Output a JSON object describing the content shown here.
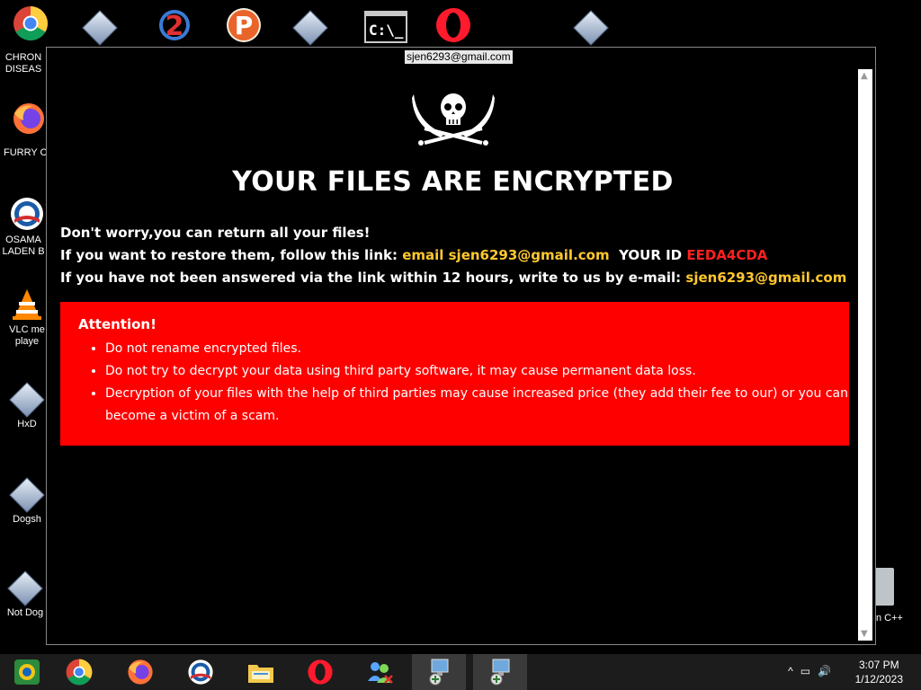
{
  "desktop": {
    "icons_left": [
      {
        "label_line1": "CHRON",
        "label_line2": "DISEAS",
        "icon": "chrome-icon"
      },
      {
        "label_line1": "FURRY CU",
        "label_line2": "",
        "icon": "firefox-icon"
      },
      {
        "label_line1": "OSAMA",
        "label_line2": "LADEN B",
        "icon": "obama-icon"
      },
      {
        "label_line1": "VLC me",
        "label_line2": "playe",
        "icon": "vlc-icon"
      },
      {
        "label_line1": "HxD",
        "label_line2": "",
        "icon": "app-icon"
      },
      {
        "label_line1": "Dogsh",
        "label_line2": "",
        "icon": "app-icon"
      },
      {
        "label_line1": "Not Dog",
        "label_line2": "",
        "icon": "app-icon"
      }
    ],
    "icon_right_label": "n C++",
    "top_row_icons": [
      "chrome-icon",
      "app-icon",
      "number2-icon",
      "p-icon",
      "app-icon",
      "cmd-icon",
      "opera-icon",
      "app-icon"
    ]
  },
  "window": {
    "title": "sjen6293@gmail.com",
    "heading": "YOUR FILES ARE ENCRYPTED",
    "line1": "Don't worry,you can return all your files!",
    "line2_prefix": "If you want to restore them, follow this link: ",
    "line2_link": "email sjen6293@gmail.com",
    "line2_id_label": "YOUR ID ",
    "line2_id_value": "EEDA4CDA",
    "line3_prefix": "If you have not been answered via the link within 12 hours, write to us by e-mail: ",
    "line3_email": "sjen6293@gmail.com",
    "attention_title": "Attention!",
    "attention_items": [
      "Do not rename encrypted files.",
      "Do not try to decrypt your data using third party software, it may cause permanent data loss.",
      "Decryption of your files with the help of third parties may cause increased price (they add their fee to our) or you can become a victim of a scam."
    ]
  },
  "taskbar": {
    "items": [
      "start-icon",
      "chrome-icon",
      "firefox-icon",
      "obama-icon",
      "explorer-icon",
      "opera-icon",
      "people-icon",
      "network-app-icon",
      "network-app-icon"
    ],
    "time": "3:07 PM",
    "date": "1/12/2023"
  },
  "colors": {
    "accent_yellow": "#ffc82e",
    "accent_red_text": "#ff2020",
    "alert_background": "#ff0000"
  }
}
